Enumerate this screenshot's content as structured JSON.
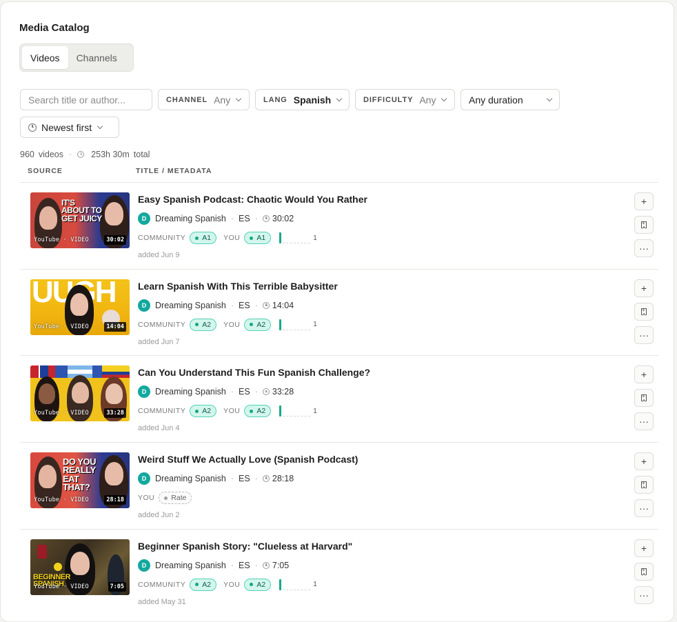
{
  "page": {
    "title": "Media Catalog"
  },
  "tabs": [
    {
      "label": "Videos",
      "active": true
    },
    {
      "label": "Channels",
      "active": false
    }
  ],
  "filters": {
    "search_placeholder": "Search title or author...",
    "channel": {
      "label": "CHANNEL",
      "value": "Any"
    },
    "lang": {
      "label": "LANG",
      "value": "Spanish"
    },
    "difficulty": {
      "label": "DIFFICULTY",
      "value": "Any"
    },
    "duration": {
      "value": "Any duration"
    },
    "sort": {
      "value": "Newest first"
    }
  },
  "summary": {
    "count": "960",
    "count_unit": "videos",
    "total_time": "253h 30m",
    "total_label": "total"
  },
  "columns": {
    "source": "SOURCE",
    "title": "TITLE / METADATA"
  },
  "labels": {
    "community": "COMMUNITY",
    "you": "YOU",
    "rate": "Rate",
    "source": "YouTube",
    "type": "VIDEO"
  },
  "videos": [
    {
      "title": "Easy Spanish Podcast: Chaotic Would You Rather",
      "channel": "Dreaming Spanish",
      "channel_initial": "D",
      "lang": "ES",
      "duration": "30:02",
      "thumb_text": "IT'S ABOUT TO GET JUICY",
      "community_level": "A1",
      "you_level": "A1",
      "ratings_count": "1",
      "added": "added Jun 9"
    },
    {
      "title": "Learn Spanish With This Terrible Babysitter",
      "channel": "Dreaming Spanish",
      "channel_initial": "D",
      "lang": "ES",
      "duration": "14:04",
      "thumb_text": "UUGH",
      "community_level": "A2",
      "you_level": "A2",
      "ratings_count": "1",
      "added": "added Jun 7"
    },
    {
      "title": "Can You Understand This Fun Spanish Challenge?",
      "channel": "Dreaming Spanish",
      "channel_initial": "D",
      "lang": "ES",
      "duration": "33:28",
      "thumb_text": "",
      "community_level": "A2",
      "you_level": "A2",
      "ratings_count": "1",
      "added": "added Jun 4"
    },
    {
      "title": "Weird Stuff We Actually Love (Spanish Podcast)",
      "channel": "Dreaming Spanish",
      "channel_initial": "D",
      "lang": "ES",
      "duration": "28:18",
      "thumb_text": "DO YOU REALLY EAT THAT?",
      "community_level": null,
      "you_level": null,
      "ratings_count": null,
      "added": "added Jun 2"
    },
    {
      "title": "Beginner Spanish Story: \"Clueless at Harvard\"",
      "channel": "Dreaming Spanish",
      "channel_initial": "D",
      "lang": "ES",
      "duration": "7:05",
      "thumb_text": "BEGINNER SPANISH",
      "community_level": "A2",
      "you_level": "A2",
      "ratings_count": "1",
      "added": "added May 31"
    }
  ],
  "colors": {
    "accent_teal": "#13a89e",
    "pill_bg": "#d3f6ec",
    "pill_border": "#52d0b7"
  }
}
